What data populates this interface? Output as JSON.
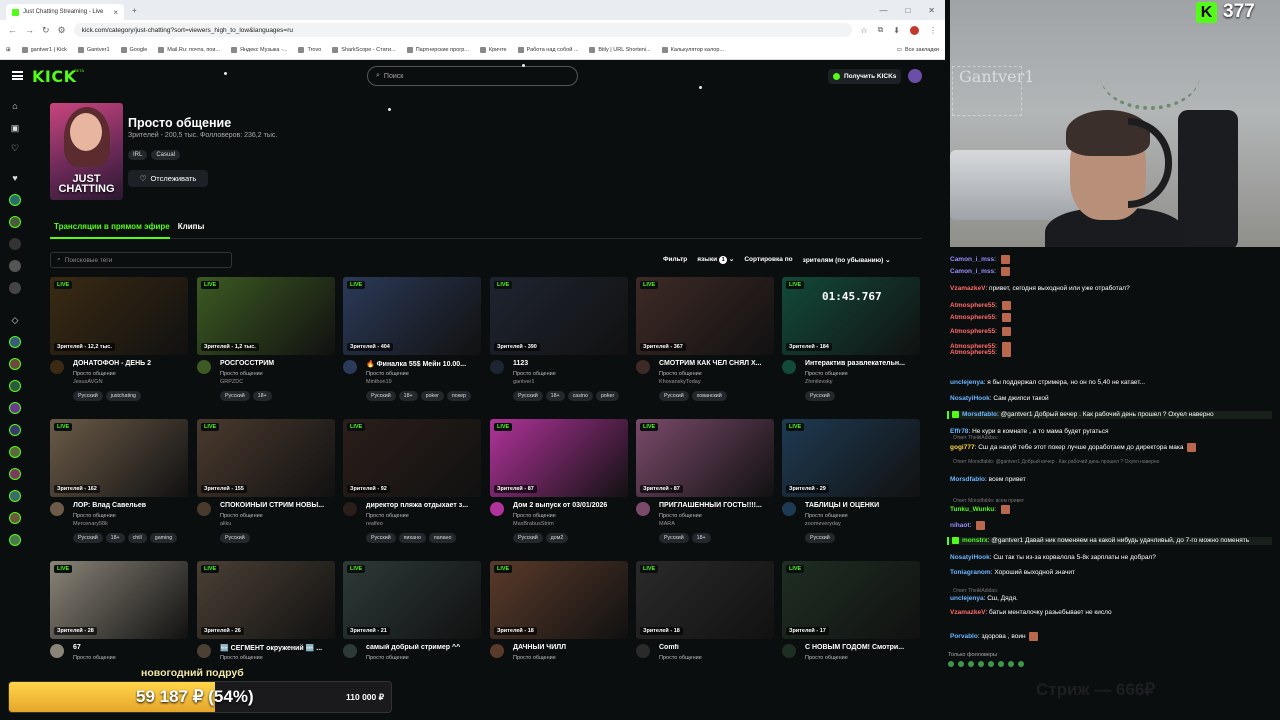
{
  "browser": {
    "tab_title": "Just Chatting Streaming - Live",
    "tab_close": "×",
    "new_tab": "+",
    "window_controls": [
      "—",
      "□",
      "✕"
    ],
    "url": "kick.com/category/just-chatting?sort=viewers_high_to_low&languages=ru",
    "bookmarks": [
      "gantver1 | Kick",
      "Gantver1",
      "Google",
      "Mail.Ru: почта, пои...",
      "Яндекс Музыка -...",
      "Trovo",
      "SharkScope - Стати...",
      "Партнерские прогр...",
      "Кричте",
      "Работа над собой ...",
      "Bitly | URL Shorteni...",
      "Калькулятор калор..."
    ],
    "bookmarks_all": "Все закладки"
  },
  "site": {
    "logo": "KICK",
    "logo_beta": "BETA",
    "search_placeholder": "Поиск",
    "get_kicks": "Получить KICKs",
    "brand_color": "#53fc18"
  },
  "category": {
    "cover_text": "JUST CHATTING",
    "title": "Просто общение",
    "stats": "Зрителей - 200,5 тыс.  Фолловеров: 236,2 тыс.",
    "tags": [
      "IRL",
      "Casual"
    ],
    "follow": "Отслеживать"
  },
  "tabs": [
    "Трансляции в прямом эфире",
    "Клипы"
  ],
  "filters": {
    "tag_search_placeholder": "Поисковые теги",
    "filter": "Фильтр",
    "languages": "языки",
    "languages_count": "1",
    "sort_label": "Сортировка по",
    "sort_value": "зрителям (по убыванию)"
  },
  "live_badge": "LIVE",
  "streams": [
    {
      "viewers": "Зрителей - 12,2 тыс.",
      "title": "ДОНАТОФОН - ДЕНЬ 2",
      "category": "Просто общение",
      "user": "JesusAVGN",
      "tags": [
        "Русский",
        "justchating"
      ],
      "thumb": "#3a2a12"
    },
    {
      "viewers": "Зрителей - 1,2 тыс.",
      "title": "РОСГОССТРИМ",
      "category": "Просто общение",
      "user": "GRPZDC",
      "tags": [
        "Русский",
        "18+"
      ],
      "thumb": "#3c5a22"
    },
    {
      "viewers": "Зрителей - 404",
      "title": "🔥 Финалка 55$ Мейн 10.00...",
      "category": "Просто общение",
      "user": "Minthon19",
      "tags": [
        "Русский",
        "18+",
        "poker",
        "покер"
      ],
      "thumb": "#2b3a58"
    },
    {
      "viewers": "Зрителей - 390",
      "title": "1123",
      "category": "Просто общение",
      "user": "gantver1",
      "tags": [
        "Русский",
        "18+",
        "casino",
        "poker"
      ],
      "thumb": "#1e2430"
    },
    {
      "viewers": "Зрителей - 367",
      "title": "СМОТРИМ КАК ЧЕЛ СНЯЛ Х...",
      "category": "Просто общение",
      "user": "KhovanskyToday",
      "tags": [
        "Русский",
        "хованский"
      ],
      "thumb": "#3e2a26"
    },
    {
      "viewers": "Зрителей - 184",
      "title": "Интерактив развлекательн...",
      "category": "Просто общение",
      "user": "Zhmilevsky",
      "tags": [
        "Русский"
      ],
      "thumb": "#124a3a",
      "timer": "01:45.767"
    },
    {
      "viewers": "Зрителей - 162",
      "title": "ЛОР: Влад Савельев",
      "category": "Просто общение",
      "user": "Mercenary58k",
      "tags": [
        "Русский",
        "18+",
        "chill",
        "gaming"
      ],
      "thumb": "#6b5b48"
    },
    {
      "viewers": "Зрителей - 155",
      "title": "СПОКОЙНЫЙ СТРИМ НОВЫ...",
      "category": "Просто общение",
      "user": "aliku",
      "tags": [
        "Русский"
      ],
      "thumb": "#4a3a2e"
    },
    {
      "viewers": "Зрителей - 92",
      "title": "директор пляжа отдыхает з...",
      "category": "Просто общение",
      "user": "realfeo",
      "tags": [
        "Русский",
        "пихано",
        "папано"
      ],
      "thumb": "#2a1e1a"
    },
    {
      "viewers": "Зрителей - 87",
      "title": "Дом 2 выпуск от 03/01/2026",
      "category": "Просто общение",
      "user": "MaxBrabusStrim",
      "tags": [
        "Русский",
        "дом2"
      ],
      "thumb": "#b0339a"
    },
    {
      "viewers": "Зрителей - 87",
      "title": "ПРИГЛАШЕННЫЙ ГОСТЬ!!!!...",
      "category": "Просто общение",
      "user": "MARA",
      "tags": [
        "Русский",
        "18+"
      ],
      "thumb": "#7a4a6a"
    },
    {
      "viewers": "Зрителей - 29",
      "title": "ТАБЛИЦЫ И ОЦЕНКИ",
      "category": "Просто общение",
      "user": "zoomeveryday",
      "tags": [
        "Русский"
      ],
      "thumb": "#1e3a52"
    },
    {
      "viewers": "Зрителей - 28",
      "title": "67",
      "category": "Просто общение",
      "user": "",
      "tags": [],
      "thumb": "#8a8478"
    },
    {
      "viewers": "Зрителей - 26",
      "title": "🆕 СЕГМЕНТ окружений 🆕 ...",
      "category": "Просто общение",
      "user": "",
      "tags": [],
      "thumb": "#4a4034"
    },
    {
      "viewers": "Зрителей - 21",
      "title": "самый добрый стример ^^",
      "category": "Просто общение",
      "user": "",
      "tags": [],
      "thumb": "#2c3a38"
    },
    {
      "viewers": "Зрителей - 18",
      "title": "ДАЧНЫЙ ЧИЛЛ",
      "category": "Просто общение",
      "user": "",
      "tags": [],
      "thumb": "#5a3a2a"
    },
    {
      "viewers": "Зрителей - 18",
      "title": "Comfi",
      "category": "Просто общение",
      "user": "",
      "tags": [],
      "thumb": "#2a2a2a"
    },
    {
      "viewers": "Зрителей - 17",
      "title": "С НОВЫМ ГОДОМ! Смотри...",
      "category": "Просто общение",
      "user": "",
      "tags": [],
      "thumb": "#1e2e22"
    }
  ],
  "webcam": {
    "wall_text": "Gantver1",
    "viewer_count": "377"
  },
  "chat": {
    "messages": [
      {
        "user": "Camon_i_mss",
        "text": "",
        "color": "#9b8cff",
        "img": true
      },
      {
        "user": "Camon_i_mss",
        "text": "",
        "color": "#9b8cff",
        "img": true
      },
      {
        "user": "VzamazkeV",
        "text": "привет, сегодня выходной или уже отработал?",
        "color": "#ff6b6b"
      },
      {
        "user": "Atmosphere55",
        "text": "",
        "color": "#ff6b6b",
        "img": true
      },
      {
        "user": "Atmosphere55",
        "text": "",
        "color": "#ff6b6b",
        "img": true
      },
      {
        "user": "Atmosphere55",
        "text": "",
        "color": "#ff6b6b",
        "img": true
      },
      {
        "user": "Atmosphere55",
        "text": "",
        "color": "#ff6b6b",
        "img": true
      },
      {
        "user": "Atmosphere55",
        "text": "",
        "color": "#ff6b6b",
        "img": true
      },
      {
        "user": "unclejenya",
        "text": "я бы поддержал стримера, но он по 5,40 не катает...",
        "color": "#6bb6ff"
      },
      {
        "user": "NosatyiHook",
        "text": "Сам джипси такой",
        "color": "#6bb6ff"
      },
      {
        "user": "Morsdfablo",
        "text": "@gantver1 Добрый вечер . Как рабочий день прошел ? Охуел наверно",
        "color": "#6bb6ff",
        "hl": true
      },
      {
        "user": "Effr78",
        "text": "Не кури в комнате , а то мама будет ругаться",
        "color": "#6bb6ff"
      },
      {
        "user": "gogi777",
        "text": "Сш да нахуй тебе этот покер лучше доработаем до директора мака",
        "color": "#ffd34d",
        "img": true
      },
      {
        "user": "Morsdfablo",
        "text": "всем привет",
        "color": "#6bb6ff"
      },
      {
        "user": "Tunku_Wunku",
        "text": "",
        "color": "#53fc18",
        "img": true
      },
      {
        "user": "nihaot",
        "text": "",
        "color": "#9b8cff",
        "img": true
      },
      {
        "user": "monstrx",
        "text": "@gantver1 Давай ник поменяем на какой нибудь удачливый, до 7-го можно поменять",
        "color": "#53fc18",
        "hl": true
      },
      {
        "user": "NosatyiHook",
        "text": "Сш так ты из-за корвалола 5-8к зарплаты не добрал?",
        "color": "#6bb6ff"
      },
      {
        "user": "Toniagranom",
        "text": "Хороший выходной значит",
        "color": "#6bb6ff"
      },
      {
        "user": "unclejenya",
        "text": "Сш, Дядя.",
        "color": "#6bb6ff"
      },
      {
        "user": "VzamazkeV",
        "text": "батьи менталочку разьебывает не кисло",
        "color": "#ff6b6b"
      },
      {
        "user": "Porvablo",
        "text": "здорова , воин",
        "color": "#6bb6ff",
        "img": true
      }
    ],
    "replies": [
      {
        "after": 12,
        "text": "Ответ Morsdfablo: @gantver1 Добрый вечер . Как рабочий день прошел ? Охуел наверно"
      },
      {
        "after": 13,
        "text": "Ответ Morsdfablo: всем привет"
      },
      {
        "after": 19,
        "text": "Ответ TheiklAdidas:"
      },
      {
        "after": 11,
        "text": "Ответ TheiklAdidas:"
      }
    ],
    "followers_only": "Только фолловеры"
  },
  "donation": {
    "title": "новогодний подруб",
    "current": "59 187 ₽ (54%)",
    "goal": "110 000 ₽",
    "progress": 0.54
  },
  "overlay_text": "Стриж — 666₽"
}
